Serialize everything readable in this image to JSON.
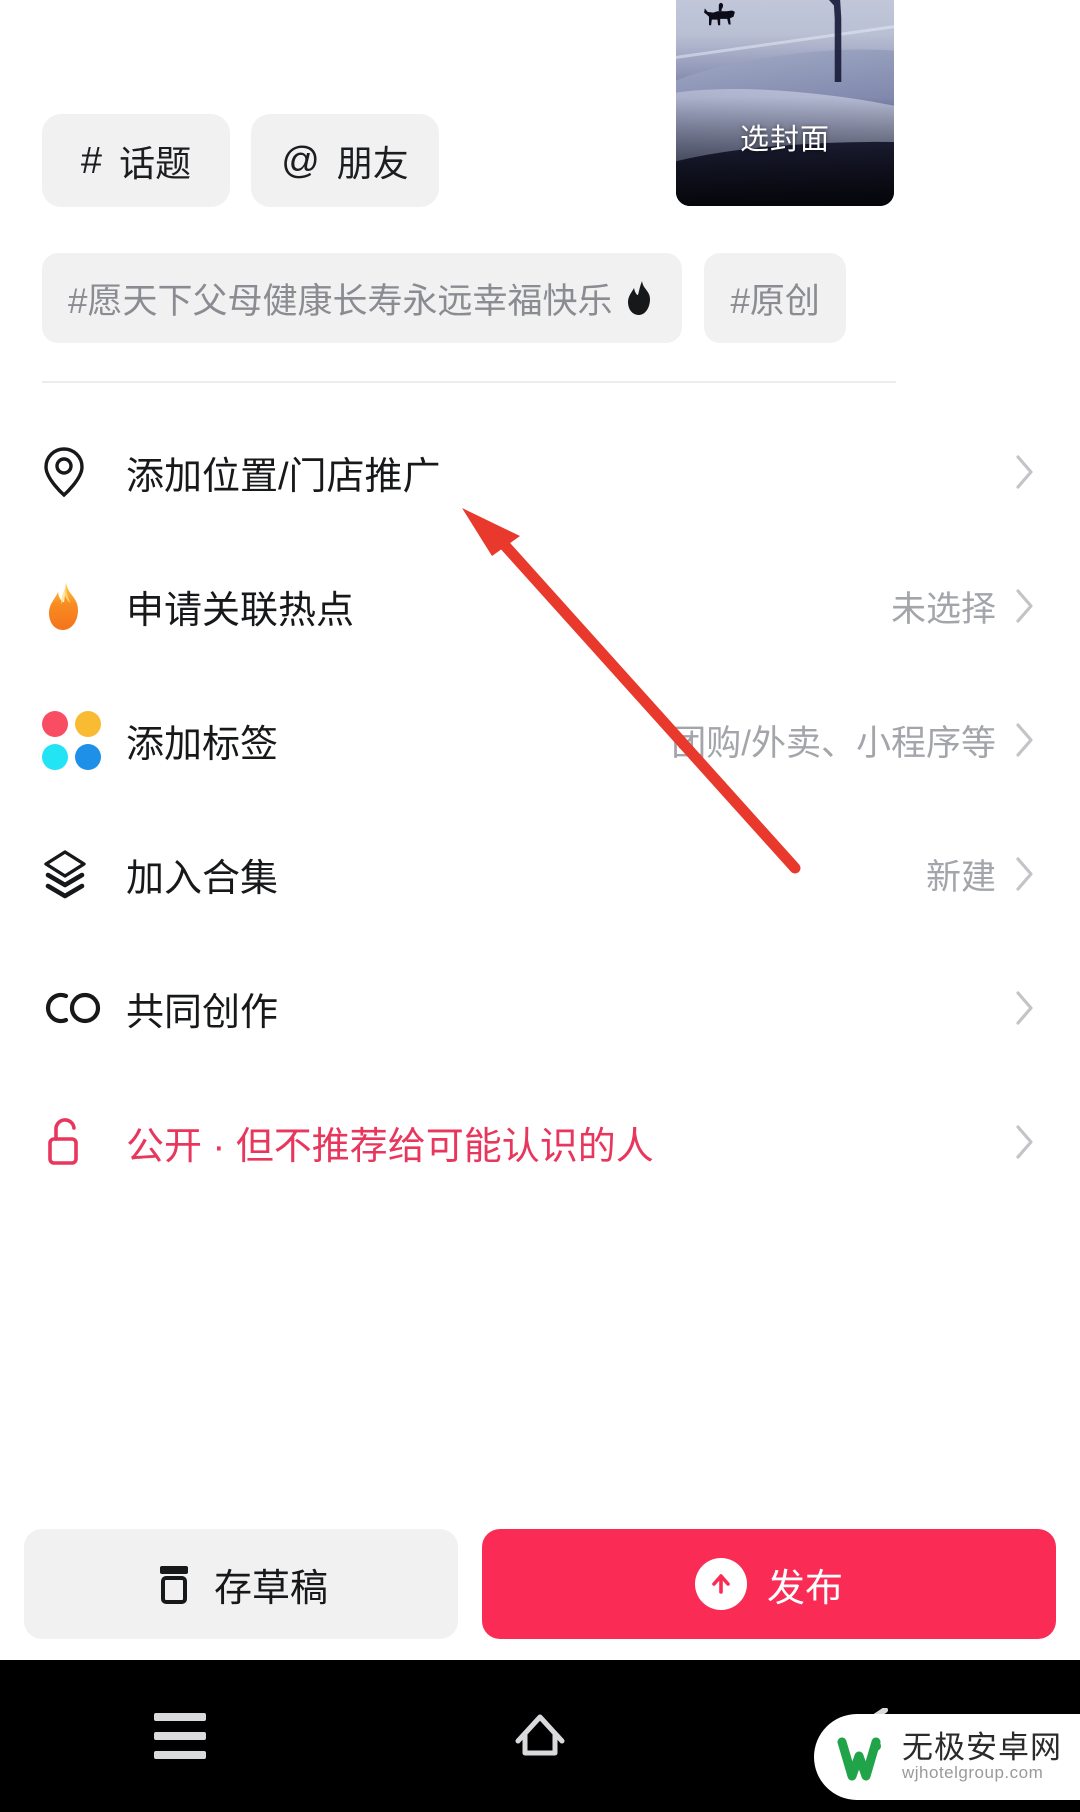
{
  "cover": {
    "label": "选封面",
    "icon": "cover-thumbnail"
  },
  "quick_actions": [
    {
      "symbol": "#",
      "label": "话题",
      "name": "topic"
    },
    {
      "symbol": "@",
      "label": "朋友",
      "name": "friend"
    }
  ],
  "topic_suggestions": [
    {
      "text": "#愿天下父母健康长寿永远幸福快乐",
      "hot": "🔥"
    },
    {
      "text": "#原创",
      "hot": ""
    }
  ],
  "settings_rows": [
    {
      "icon": "location-pin-icon",
      "label": "添加位置/门店推广",
      "value": "",
      "chevron": "›"
    },
    {
      "icon": "flame-icon",
      "label": "申请关联热点",
      "value": "未选择",
      "chevron": "›"
    },
    {
      "icon": "four-dots-icon",
      "label": "添加标签",
      "value": "团购/外卖、小程序等",
      "chevron": "›"
    },
    {
      "icon": "layers-icon",
      "label": "加入合集",
      "value": "新建",
      "chevron": "›"
    },
    {
      "icon": "co-create-icon",
      "label": "共同创作",
      "value": "",
      "chevron": "›"
    },
    {
      "icon": "unlock-icon",
      "label": "公开 · 但不推荐给可能认识的人",
      "value": "",
      "chevron": "›"
    }
  ],
  "footer": {
    "draft_label": "存草稿",
    "publish_label": "发布"
  },
  "navbar": {
    "menu": "menu-icon",
    "home": "home-icon",
    "back": "back-icon"
  },
  "watermark": {
    "cn": "无极安卓网",
    "en": "wjhotelgroup.com"
  },
  "colors": {
    "accent": "#fa2c55",
    "privacy_text": "#e8365d",
    "chip_bg": "#f1f1f2",
    "muted_text": "#a3a5aa",
    "dot_red": "#f94d63",
    "dot_yellow": "#f9bb32",
    "dot_cyan": "#22e4f5",
    "dot_blue": "#1e90e8",
    "flame": "#f58220",
    "annotation_arrow": "#e8392c"
  }
}
